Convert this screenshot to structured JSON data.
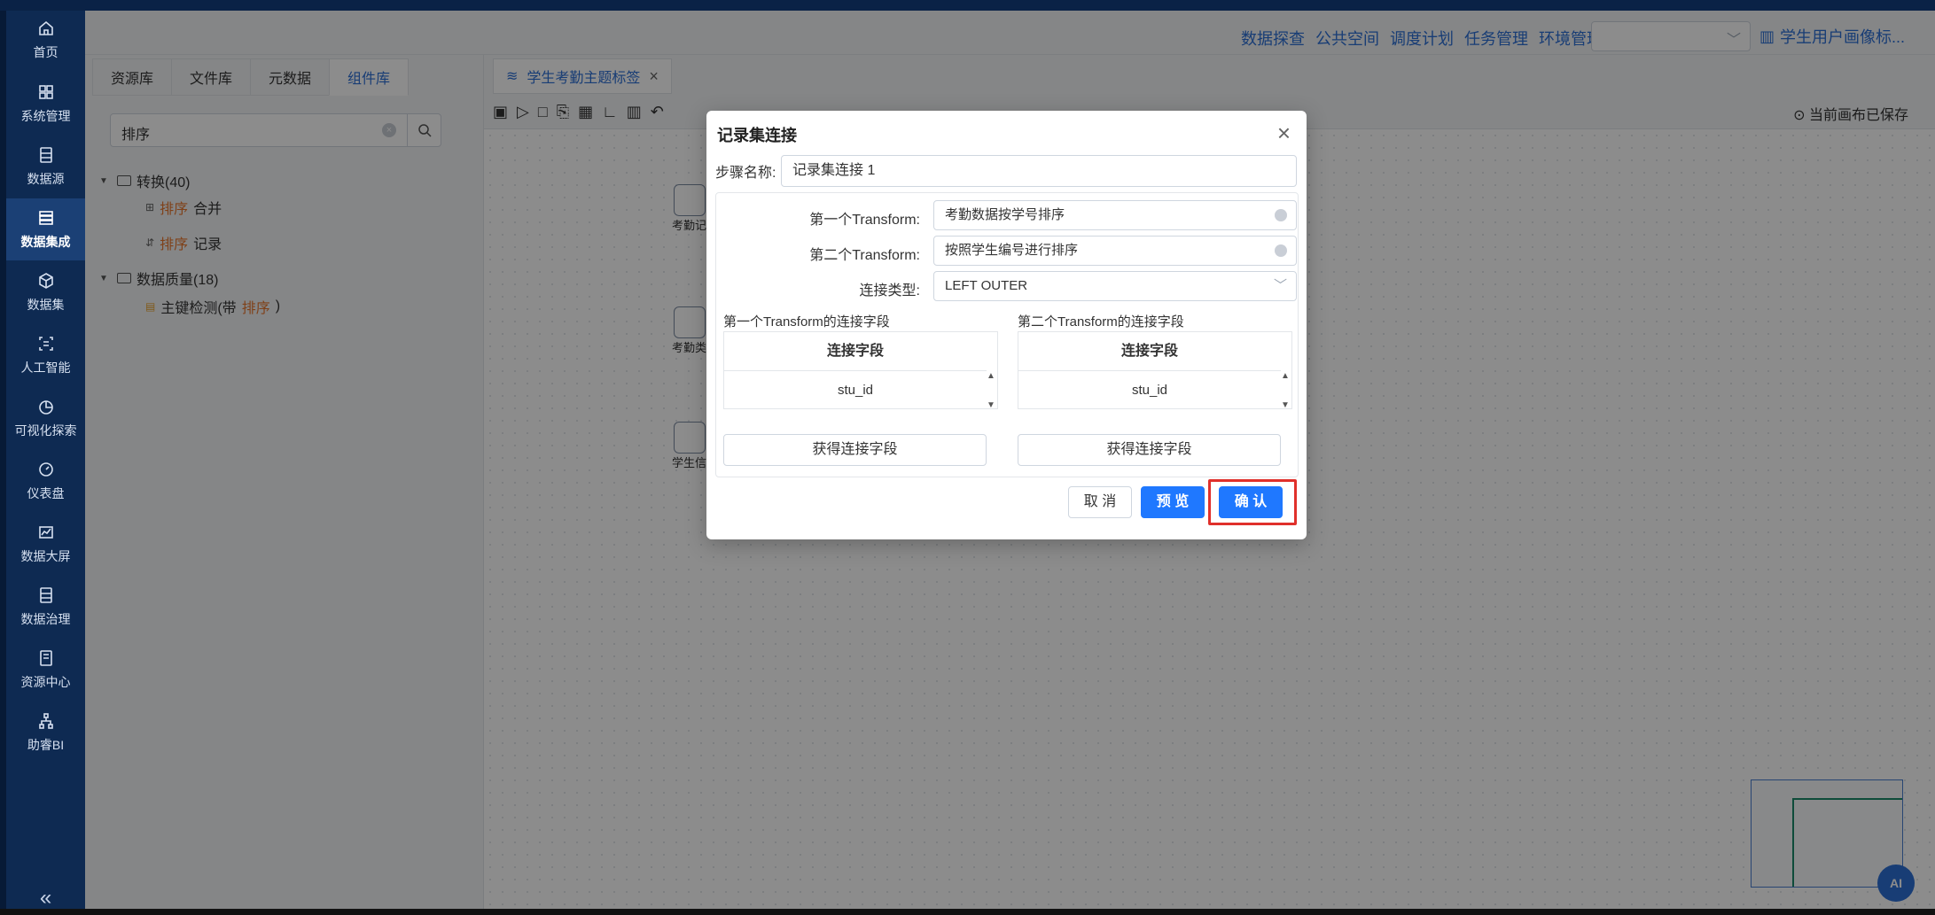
{
  "nav": {
    "items": [
      {
        "label": "首页",
        "icon": "home-icon"
      },
      {
        "label": "系统管理",
        "icon": "grid-icon"
      },
      {
        "label": "数据源",
        "icon": "database-icon"
      },
      {
        "label": "数据集成",
        "icon": "stack-icon",
        "active": true
      },
      {
        "label": "数据集",
        "icon": "cube-icon"
      },
      {
        "label": "人工智能",
        "icon": "scan-icon"
      },
      {
        "label": "可视化探索",
        "icon": "pie-icon"
      },
      {
        "label": "仪表盘",
        "icon": "gauge-icon"
      },
      {
        "label": "数据大屏",
        "icon": "chart-icon"
      },
      {
        "label": "数据治理",
        "icon": "list-icon"
      },
      {
        "label": "资源中心",
        "icon": "folder-icon"
      },
      {
        "label": "助睿BI",
        "icon": "org-icon"
      }
    ],
    "collapse_label": "«"
  },
  "topbar": {
    "links": [
      "数据探查",
      "公共空间",
      "调度计划",
      "任务管理",
      "环境管理"
    ],
    "select_value": "",
    "user_label": "学生用户画像标..."
  },
  "leftpanel": {
    "tabs": [
      "资源库",
      "文件库",
      "元数据",
      "组件库"
    ],
    "active_tab": 3,
    "search_value": "排序",
    "tree": {
      "group1": "转换(40)",
      "item1_hl": "排序",
      "item1_rest": "合并",
      "item2_hl": "排序",
      "item2_rest": "记录",
      "group2": "数据质量(18)",
      "item3_pre": "主键检测(带",
      "item3_hl": "排序",
      "item3_post": ")"
    }
  },
  "canvas": {
    "tab_label": "学生考勤主题标签",
    "saved_label": "当前画布已保存",
    "node_labels": [
      "考勤记",
      "考勤类",
      "学生信"
    ]
  },
  "dialog": {
    "title": "记录集连接",
    "step_label": "步骤名称:",
    "step_value": "记录集连接 1",
    "first_transform_label": "第一个Transform:",
    "first_transform_value": "考勤数据按学号排序",
    "second_transform_label": "第二个Transform:",
    "second_transform_value": "按照学生编号进行排序",
    "join_type_label": "连接类型:",
    "join_type_value": "LEFT OUTER",
    "left_fields_label": "第一个Transform的连接字段",
    "right_fields_label": "第二个Transform的连接字段",
    "field_header": "连接字段",
    "left_field_value": "stu_id",
    "right_field_value": "stu_id",
    "get_fields_label": "获得连接字段",
    "cancel_label": "取 消",
    "preview_label": "预 览",
    "confirm_label": "确 认"
  },
  "ai_label": "AI"
}
